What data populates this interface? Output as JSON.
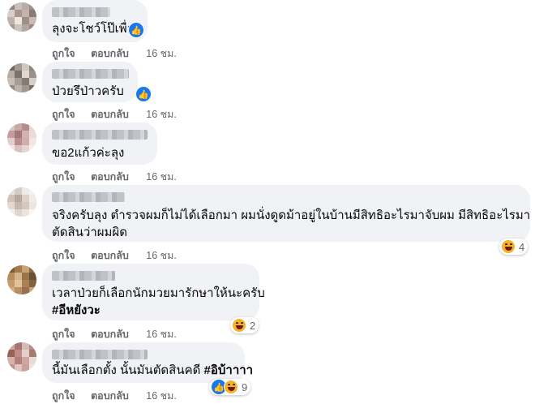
{
  "actions": {
    "like": "ถูกใจ",
    "reply": "ตอบกลับ",
    "time": "16 ชม."
  },
  "colors": {
    "bubble": "#f0f2f5",
    "like_blue": "#1877f2",
    "haha_yellow": "#f7b125",
    "meta_gray": "#65676b"
  },
  "comments": [
    {
      "text": "ลุงจะโชว์โป๊เพื่อ",
      "reactions": [
        "like-icon"
      ],
      "count": ""
    },
    {
      "text": "ป่วยรึป่าวครับ",
      "reactions": [
        "like-icon"
      ],
      "count": ""
    },
    {
      "text": "ขอ2แก้วค่ะลุง",
      "reactions": [],
      "count": ""
    },
    {
      "text": "จริงครับลุง ตำรวจผมก็ไม่ได้เลือกมา ผมนั่งดูดม้าอยู่ในบ้านมีสิทธิอะไรมาจับผม มีสิทธิอะไรมา",
      "text2": "ตัดสินว่าผมผิด",
      "reactions": [
        "haha-icon"
      ],
      "count": "4"
    },
    {
      "text": "เวลาป่วยก็เลือกนักมวยมารักษาให้นะครับ",
      "hashtag": "#อีหยังวะ",
      "reactions": [
        "haha-icon"
      ],
      "count": "2"
    },
    {
      "text": "นี้มันเลือกตั้ง นั้นมันตัดสินคดี ",
      "hashtag": "#อิบ้าาาา",
      "reactions": [
        "like-icon",
        "haha-icon"
      ],
      "count": "9"
    }
  ]
}
